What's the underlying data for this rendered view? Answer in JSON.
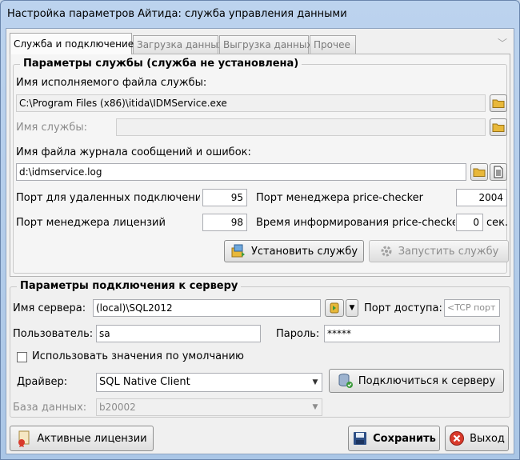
{
  "window": {
    "title": "Настройка параметров Айтида: служба управления данными"
  },
  "tabs": [
    {
      "label": "Служба и подключение"
    },
    {
      "label": "Загрузка данных"
    },
    {
      "label": "Выгрузка данных"
    },
    {
      "label": "Прочее"
    }
  ],
  "service": {
    "group_title": "Параметры службы (служба не установлена)",
    "exe_label": "Имя исполняемого файла службы:",
    "exe_value": "C:\\Program Files (x86)\\itida\\IDMService.exe",
    "name_label": "Имя службы:",
    "name_value": "",
    "log_label": "Имя файла журнала сообщений и ошибок:",
    "log_value": "d:\\idmservice.log",
    "remote_port_label": "Порт для удаленных подключений",
    "remote_port_value": "95",
    "pc_port_label": "Порт менеджера price-checker",
    "pc_port_value": "2004",
    "lic_port_label": "Порт менеджера лицензий",
    "lic_port_value": "98",
    "pc_time_label": "Время информирования price-checker",
    "pc_time_value": "0",
    "pc_time_unit": "сек.",
    "install_button": "Установить службу",
    "start_button": "Запустить службу"
  },
  "connection": {
    "group_title": "Параметры подключения к серверу",
    "server_label": "Имя сервера:",
    "server_value": "(local)\\SQL2012",
    "port_label": "Порт доступа:",
    "port_placeholder": "<TCP порт",
    "user_label": "Пользователь:",
    "user_value": "sa",
    "password_label": "Пароль:",
    "password_value": "*****",
    "defaults_label": "Использовать значения по умолчанию",
    "defaults_checked": false,
    "driver_label": "Драйвер:",
    "driver_value": "SQL Native Client",
    "connect_button": "Подключиться к  серверу",
    "db_label": "База данных:",
    "db_value": "b20002"
  },
  "footer": {
    "licenses_button": "Активные лицензии",
    "save_button": "Сохранить",
    "exit_button": "Выход"
  },
  "colors": {
    "accent": "#4a7fc1",
    "folder_icon": "#e8b83a",
    "exit_icon": "#d93a2b",
    "save_icon": "#2d4f86"
  }
}
